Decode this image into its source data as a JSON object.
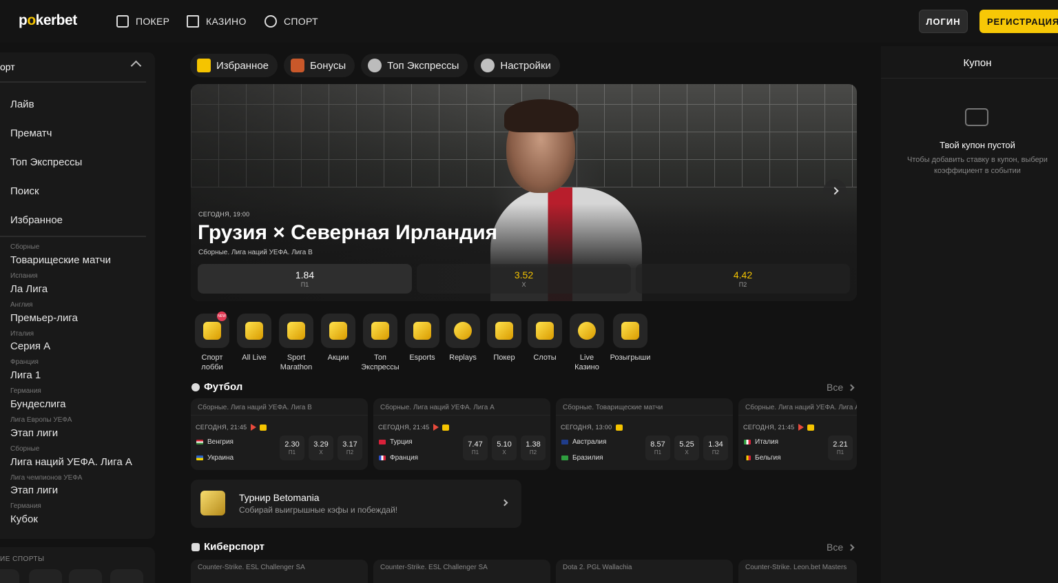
{
  "header": {
    "logo_prefix": "p",
    "logo_accent": "o",
    "logo_suffix": "kerbet",
    "nav": [
      "ПОКЕР",
      "КАЗИНО",
      "СПОРТ"
    ],
    "login": "ЛОГИН",
    "register": "РЕГИСТРАЦИЯ"
  },
  "sidebar": {
    "section": "орт",
    "items": [
      "Лайв",
      "Прематч",
      "Топ Экспрессы",
      "Поиск",
      "Избранное"
    ],
    "leagues": [
      {
        "sub": "Сборные",
        "name": "Товарищеские матчи"
      },
      {
        "sub": "Испания",
        "name": "Ла Лига"
      },
      {
        "sub": "Англия",
        "name": "Премьер-лига"
      },
      {
        "sub": "Италия",
        "name": "Серия А"
      },
      {
        "sub": "Франция",
        "name": "Лига 1"
      },
      {
        "sub": "Германия",
        "name": "Бундеслига"
      },
      {
        "sub": "Лига Европы УЕФА",
        "name": "Этап лиги"
      },
      {
        "sub": "Сборные",
        "name": "Лига наций УЕФА. Лига А"
      },
      {
        "sub": "Лига чемпионов УЕФА",
        "name": "Этап лиги"
      },
      {
        "sub": "Германия",
        "name": "Кубок"
      }
    ],
    "other_sports": "ИЕ СПОРТЫ"
  },
  "top_buttons": [
    "Избранное",
    "Бонусы",
    "Топ Экспрессы",
    "Настройки"
  ],
  "hero": {
    "date": "СЕГОДНЯ, 19:00",
    "title": "Грузия × Северная Ирландия",
    "subtitle": "Сборные. Лига наций УЕФА. Лига В",
    "odds": [
      {
        "value": "1.84",
        "label": "П1"
      },
      {
        "value": "3.52",
        "label": "Х"
      },
      {
        "value": "4.42",
        "label": "П2"
      }
    ]
  },
  "categories": [
    {
      "l1": "Спорт",
      "l2": "лобби",
      "badge": "NEW"
    },
    {
      "l1": "All Live",
      "l2": ""
    },
    {
      "l1": "Sport",
      "l2": "Marathon"
    },
    {
      "l1": "Акции",
      "l2": ""
    },
    {
      "l1": "Топ",
      "l2": "Экспрессы"
    },
    {
      "l1": "Esports",
      "l2": ""
    },
    {
      "l1": "Replays",
      "l2": ""
    },
    {
      "l1": "Покер",
      "l2": ""
    },
    {
      "l1": "Слоты",
      "l2": ""
    },
    {
      "l1": "Live",
      "l2": "Казино"
    },
    {
      "l1": "Розыгрыши",
      "l2": ""
    }
  ],
  "football": {
    "title": "Футбол",
    "all": "Все",
    "matches": [
      {
        "league": "Сборные. Лига наций УЕФА. Лига В",
        "time": "СЕГОДНЯ, 21:45",
        "team1": "Венгрия",
        "team2": "Украина",
        "odds": [
          {
            "v": "2.30",
            "l": "П1"
          },
          {
            "v": "3.29",
            "l": "Х"
          },
          {
            "v": "3.17",
            "l": "П2"
          }
        ]
      },
      {
        "league": "Сборные. Лига наций УЕФА. Лига А",
        "time": "СЕГОДНЯ, 21:45",
        "team1": "Турция",
        "team2": "Франция",
        "odds": [
          {
            "v": "7.47",
            "l": "П1"
          },
          {
            "v": "5.10",
            "l": "Х"
          },
          {
            "v": "1.38",
            "l": "П2"
          }
        ]
      },
      {
        "league": "Сборные. Товарищеские матчи",
        "time": "СЕГОДНЯ, 13:00",
        "team1": "Австралия",
        "team2": "Бразилия",
        "odds": [
          {
            "v": "8.57",
            "l": "П1"
          },
          {
            "v": "5.25",
            "l": "Х"
          },
          {
            "v": "1.34",
            "l": "П2"
          }
        ]
      },
      {
        "league": "Сборные. Лига наций УЕФА. Лига А",
        "time": "СЕГОДНЯ, 21:45",
        "team1": "Италия",
        "team2": "Бельгия",
        "odds": [
          {
            "v": "2.21",
            "l": "П1"
          }
        ]
      }
    ]
  },
  "tournament": {
    "title": "Турнир Betomania",
    "subtitle": "Собирай выигрышные кэфы и побеждай!"
  },
  "esports": {
    "title": "Киберспорт",
    "all": "Все",
    "leagues": [
      "Counter-Strike. ESL Challenger SA",
      "Counter-Strike. ESL Challenger SA",
      "Dota 2. PGL Wallachia",
      "Counter-Strike. Leon.bet Masters"
    ]
  },
  "coupon": {
    "title": "Купон",
    "empty": "Твой купон пустой",
    "hint1": "Чтобы добавить ставку в купон, выбери",
    "hint2": "коэффициент в событии"
  },
  "colors": {
    "accent": "#f7c806",
    "background": "#121212",
    "panel": "#1c1c1c"
  }
}
